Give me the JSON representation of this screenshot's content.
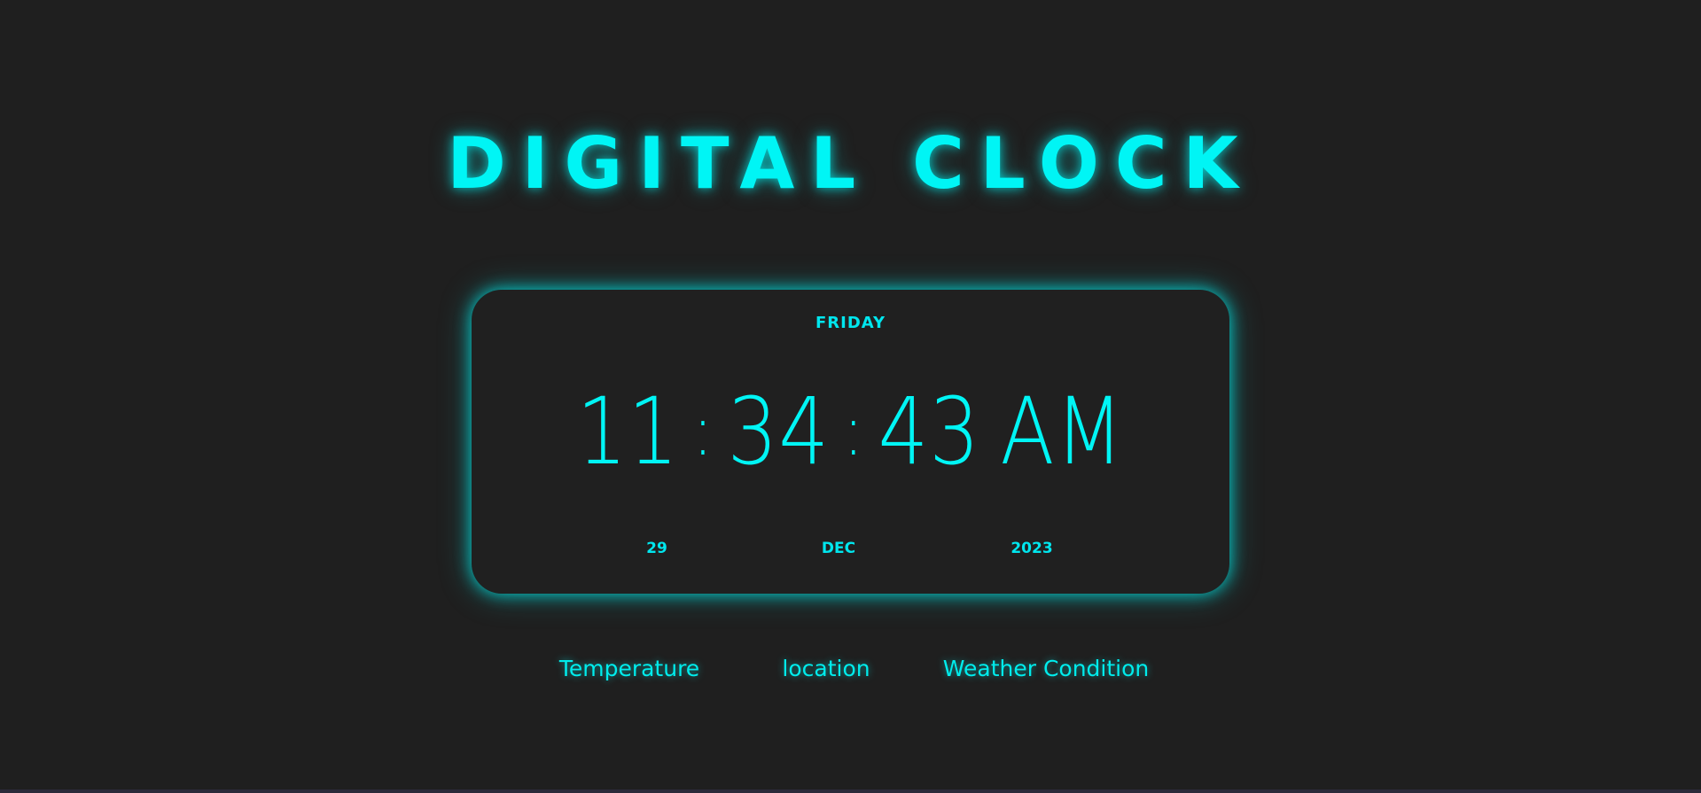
{
  "page": {
    "title": "Digital Clock",
    "accent_color": "#00f5f5",
    "background_color": "#1f1f1f"
  },
  "clock": {
    "day_name": "Friday",
    "hours": "11",
    "minutes": "34",
    "seconds": "43",
    "separator": ":",
    "period": "AM",
    "date": {
      "day": "29",
      "month": "Dec",
      "year": "2023"
    }
  },
  "weather": {
    "temperature_label": "Temperature",
    "location_label": "location",
    "condition_label": "Weather Condition"
  }
}
